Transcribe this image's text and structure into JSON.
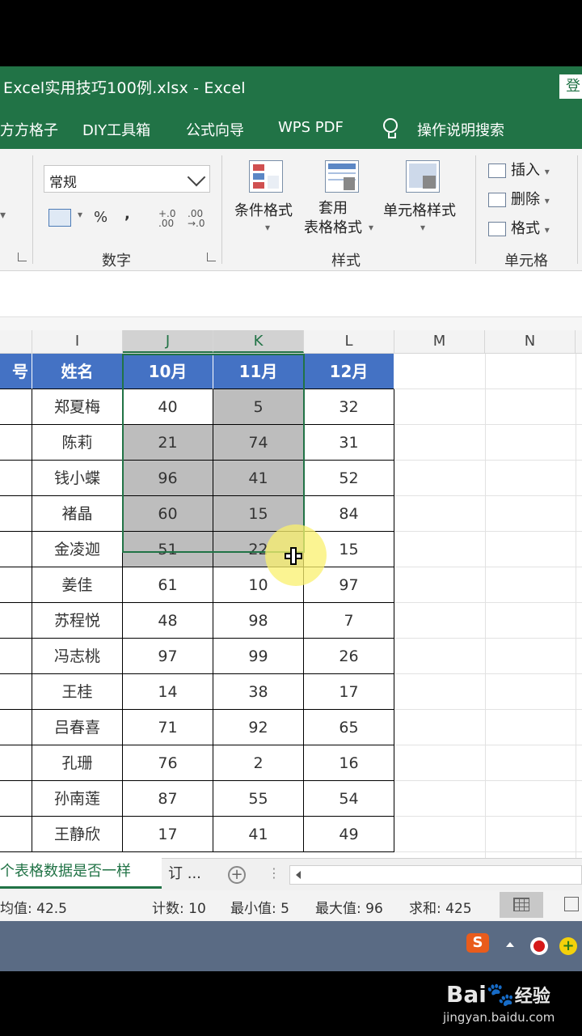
{
  "window": {
    "title": "Excel实用技巧100例.xlsx  -  Excel",
    "login": "登"
  },
  "menu": [
    "方方格子",
    "DIY工具箱",
    "公式向导",
    "WPS PDF",
    "操作说明搜索"
  ],
  "ribbon": {
    "number_format": "常规",
    "currency_icon": "currency-icon",
    "percent": "%",
    "comma": ",",
    "inc_decimal": "+.0 .00",
    "dec_decimal": ".00 →.0",
    "groups": {
      "number": "数字",
      "styles": "样式",
      "cells": "单元格"
    },
    "styles_buttons": [
      "条件格式",
      "套用\n表格格式",
      "单元格样式"
    ],
    "cell_buttons": [
      "插入",
      "删除",
      "格式"
    ]
  },
  "columns": [
    "I",
    "J",
    "K",
    "L",
    "M",
    "N"
  ],
  "table": {
    "partial_header": "号",
    "headers": [
      "姓名",
      "10月",
      "11月",
      "12月"
    ],
    "rows": [
      [
        "郑夏梅",
        "40",
        "5",
        "32"
      ],
      [
        "陈莉",
        "21",
        "74",
        "31"
      ],
      [
        "钱小蝶",
        "96",
        "41",
        "52"
      ],
      [
        "褚晶",
        "60",
        "15",
        "84"
      ],
      [
        "金凌迦",
        "51",
        "22",
        "15"
      ],
      [
        "姜佳",
        "61",
        "10",
        "97"
      ],
      [
        "苏程悦",
        "48",
        "98",
        "7"
      ],
      [
        "冯志桃",
        "97",
        "99",
        "26"
      ],
      [
        "王桂",
        "14",
        "38",
        "17"
      ],
      [
        "吕春喜",
        "71",
        "92",
        "65"
      ],
      [
        "孔珊",
        "76",
        "2",
        "16"
      ],
      [
        "孙南莲",
        "87",
        "55",
        "54"
      ],
      [
        "王静欣",
        "17",
        "41",
        "49"
      ]
    ]
  },
  "sheet_tabs": {
    "active": "个表格数据是否一样",
    "next": "订 ..."
  },
  "status": {
    "average": "均值: 42.5",
    "count": "计数: 10",
    "min": "最小值: 5",
    "max": "最大值: 96",
    "sum": "求和: 425"
  },
  "tray": {
    "ime": "S"
  },
  "watermark": {
    "brand": "Bai",
    "brand2": "经验",
    "url": "jingyan.baidu.com"
  }
}
